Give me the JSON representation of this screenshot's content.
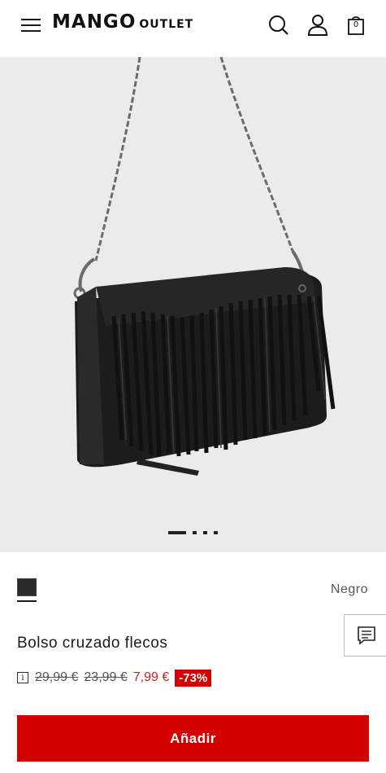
{
  "header": {
    "brand": "MANGO",
    "brand_sub": "OUTLET",
    "cart_count": "0",
    "icons": [
      "menu-icon",
      "search-icon",
      "user-icon",
      "shopping-bag-icon"
    ]
  },
  "gallery": {
    "image": "black fringed crossbody bag with chain strap",
    "slide_count": 4,
    "active_slide": 1
  },
  "product": {
    "color_name": "Negro",
    "title": "Bolso cruzado flecos",
    "prices": {
      "original": "29,99 €",
      "previous": "23,99 €",
      "current": "7,99 €",
      "discount": "-73%"
    },
    "add_label": "Añadir"
  },
  "colors": {
    "accent": "#d50000",
    "sale_text": "#d41e1e",
    "swatch": "#2b2b2b",
    "gallery_bg": "#ebebeb"
  }
}
